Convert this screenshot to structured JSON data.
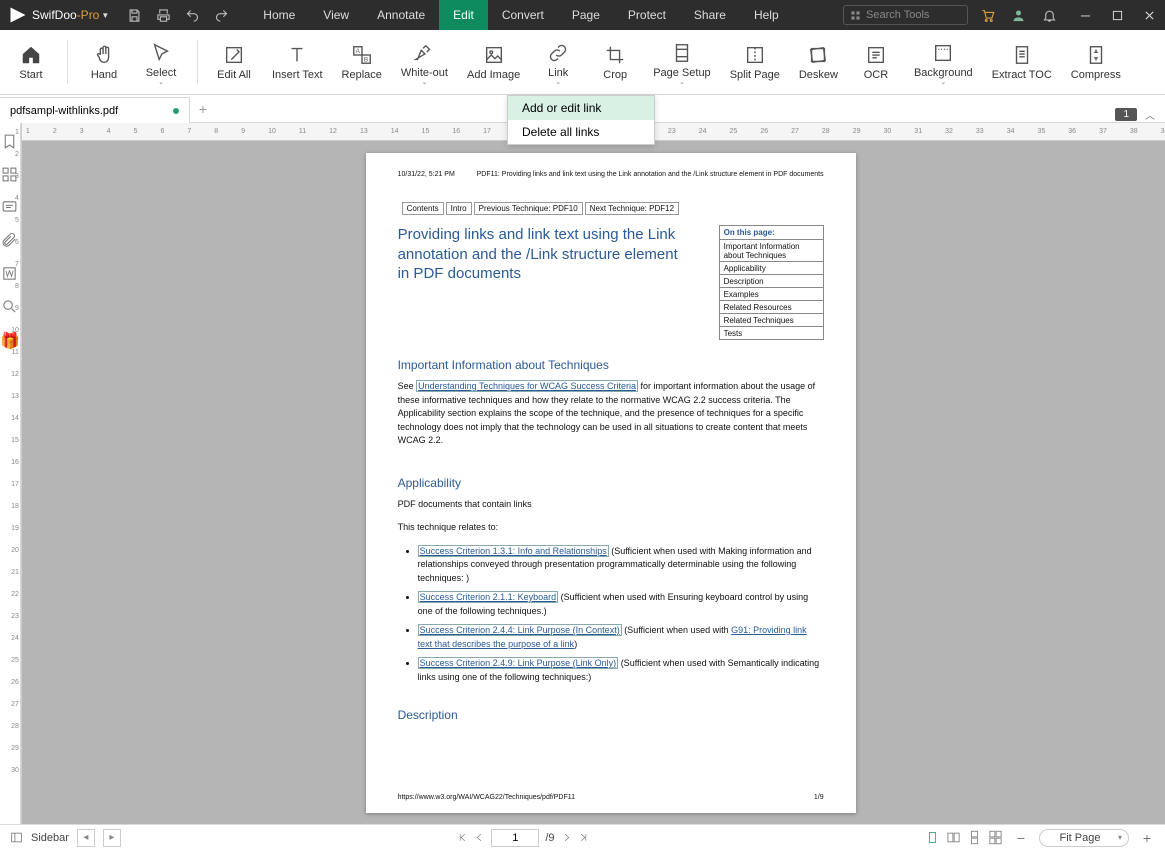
{
  "app": {
    "name": "SwifDoo",
    "suffix": "-Pro"
  },
  "menu": {
    "home": "Home",
    "view": "View",
    "annotate": "Annotate",
    "edit": "Edit",
    "convert": "Convert",
    "page": "Page",
    "protect": "Protect",
    "share": "Share",
    "help": "Help"
  },
  "search": {
    "placeholder": "Search Tools"
  },
  "ribbon": {
    "start": "Start",
    "hand": "Hand",
    "select": "Select",
    "editall": "Edit All",
    "inserttext": "Insert Text",
    "replace": "Replace",
    "whiteout": "White-out",
    "addimage": "Add Image",
    "link": "Link",
    "crop": "Crop",
    "pagesetup": "Page Setup",
    "splitpage": "Split Page",
    "deskew": "Deskew",
    "ocr": "OCR",
    "background": "Background",
    "extracttoc": "Extract TOC",
    "compress": "Compress"
  },
  "link_menu": {
    "add": "Add or edit link",
    "delete": "Delete all links"
  },
  "tab": {
    "filename": "pdfsampl-withlinks.pdf"
  },
  "page_badge": "1",
  "doc": {
    "header_left": "10/31/22, 5:21 PM",
    "header_right": "PDF11: Providing links and link text using the Link annotation and the /Link structure element in PDF documents",
    "nav": {
      "contents": "Contents",
      "intro": "Intro",
      "prev": "Previous Technique: PDF10",
      "next": "Next Technique: PDF12"
    },
    "title": "Providing links and link text using the Link annotation and the /Link structure element in PDF documents",
    "toc": {
      "hdr": "On this page:",
      "i1": "Important Information about Techniques",
      "i2": "Applicability",
      "i3": "Description",
      "i4": "Examples",
      "i5": "Related Resources",
      "i6": "Related Techniques",
      "i7": "Tests"
    },
    "h_important": "Important Information about Techniques",
    "p_see": "See ",
    "link_understanding": "Understanding Techniques for WCAG Success Criteria",
    "p_important": " for important information about the usage of these informative techniques and how they relate to the normative WCAG 2.2 success criteria. The Applicability section explains the scope of the technique, and the presence of techniques for a specific technology does not imply that the technology can be used in all situations to create content that meets WCAG 2.2.",
    "h_applic": "Applicability",
    "p_applic": "PDF documents that contain links",
    "p_relates": "This technique relates to:",
    "li1_link": "Success Criterion 1.3.1: Info and Relationships",
    "li1_txt": " (Sufficient when used with Making information and relationships conveyed through presentation programmatically determinable using the following techniques: )",
    "li2_link": "Success Criterion 2.1.1: Keyboard",
    "li2_txt": " (Sufficient when used with Ensuring keyboard control by using one of the following techniques.)",
    "li3_link": "Success Criterion 2.4.4: Link Purpose (In Context)",
    "li3_txt_a": " (Sufficient when used with ",
    "li3_link2": "G91: Providing link text that describes the purpose of a link",
    "li3_txt_b": ")",
    "li4_link": "Success Criterion 2.4.9: Link Purpose (Link Only)",
    "li4_txt": " (Sufficient when used with Semantically indicating links using one of the following techniques:)",
    "h_desc": "Description",
    "footer_left": "https://www.w3.org/WAI/WCAG22/Techniques/pdf/PDF11",
    "footer_right": "1/9"
  },
  "status": {
    "sidebar": "Sidebar",
    "page_current": "1",
    "page_total": "/9",
    "zoom": "Fit Page"
  }
}
